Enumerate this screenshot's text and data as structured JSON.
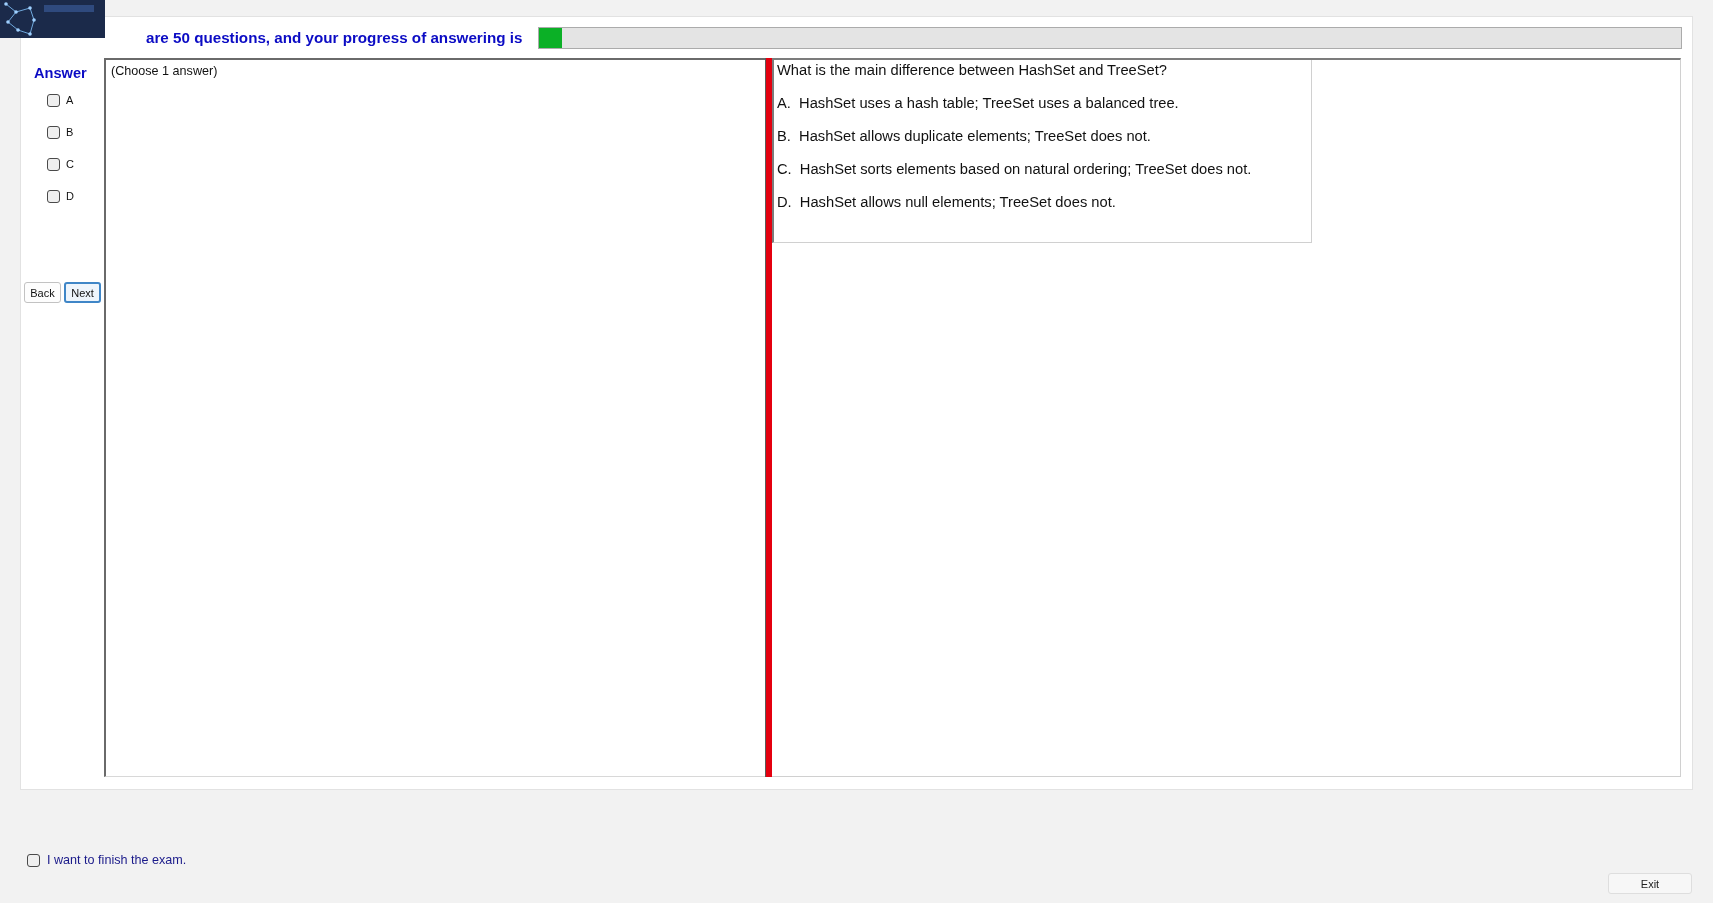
{
  "header": {
    "progress_text": "are 50 questions, and your progress of answering is",
    "progress": {
      "level": 0.02
    }
  },
  "answer_panel": {
    "title": "Answer",
    "options": [
      {
        "label": "A",
        "checked": false
      },
      {
        "label": "B",
        "checked": false
      },
      {
        "label": "C",
        "checked": false
      },
      {
        "label": "D",
        "checked": false
      }
    ],
    "back_button": {
      "label": "Back",
      "focused": false
    },
    "next_button": {
      "label": "Next",
      "focused": true
    }
  },
  "answer_pane": {
    "instruction": "(Choose 1 answer)"
  },
  "question": {
    "text": "What is the main difference between HashSet and TreeSet?",
    "choices": [
      "A.  HashSet uses a hash table; TreeSet uses a balanced tree.",
      "B.  HashSet allows duplicate elements; TreeSet does not.",
      "C.  HashSet sorts elements based on natural ordering; TreeSet does not.",
      "D.  HashSet allows null elements; TreeSet does not."
    ]
  },
  "footer": {
    "finish": {
      "label": "I want to finish the exam.",
      "checked": false
    },
    "exit_button": "Exit"
  }
}
